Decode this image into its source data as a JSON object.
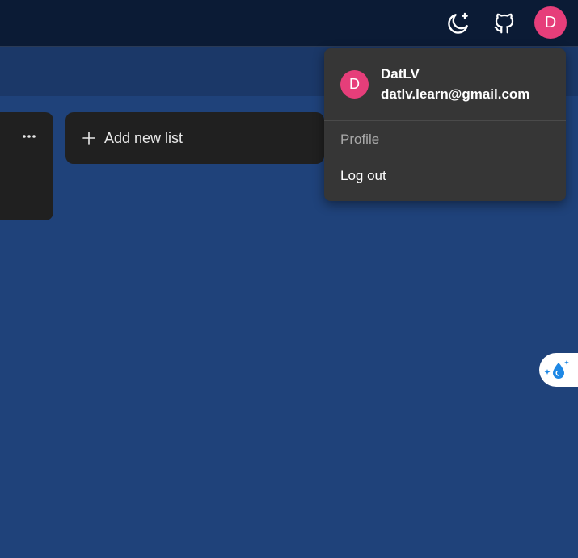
{
  "header": {
    "theme_icon": "moon-sparkle-icon",
    "github_icon": "github-icon",
    "avatar_initial": "D"
  },
  "board": {
    "add_list_label": "Add new list",
    "add_icon": "plus-icon",
    "list_menu_icon": "more-horizontal-icon"
  },
  "user_menu": {
    "avatar_initial": "D",
    "name": "DatLV",
    "email": "datlv.learn@gmail.com",
    "items": [
      {
        "label": "Profile"
      },
      {
        "label": "Log out"
      }
    ]
  },
  "floating_button": {
    "icon": "water-drop-sparkle-icon"
  },
  "colors": {
    "topbar": "#0b1b35",
    "subbar": "#1b3868",
    "board_bg": "#1f427a",
    "card_bg": "#202020",
    "menu_bg": "#363636",
    "avatar": "#e63e7a",
    "accent_blue": "#1e88e5"
  }
}
